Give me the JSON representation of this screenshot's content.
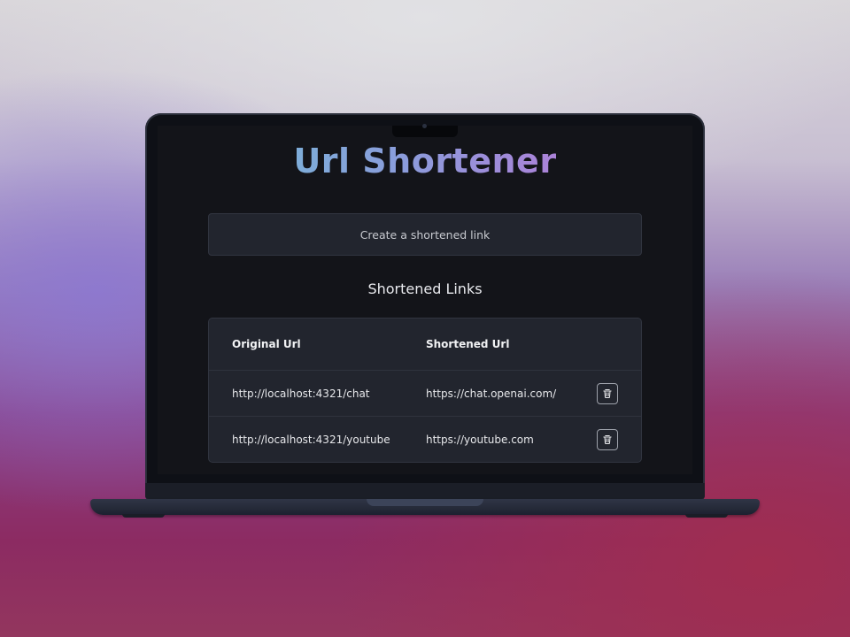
{
  "app": {
    "title": "Url Shortener",
    "create_button": "Create a shortened link",
    "section_title": "Shortened Links"
  },
  "table": {
    "headers": [
      "Original Url",
      "Shortened Url"
    ],
    "rows": [
      {
        "original": "http://localhost:4321/chat",
        "shortened": "https://chat.openai.com/",
        "action_icon": "trash-icon"
      },
      {
        "original": "http://localhost:4321/youtube",
        "shortened": "https://youtube.com",
        "action_icon": "trash-icon"
      }
    ]
  },
  "colors": {
    "title_gradient": [
      "#6ec1d6",
      "#8a9ddb",
      "#c76bd6"
    ],
    "screen_bg": "#131419",
    "card_bg": "#22252e"
  }
}
